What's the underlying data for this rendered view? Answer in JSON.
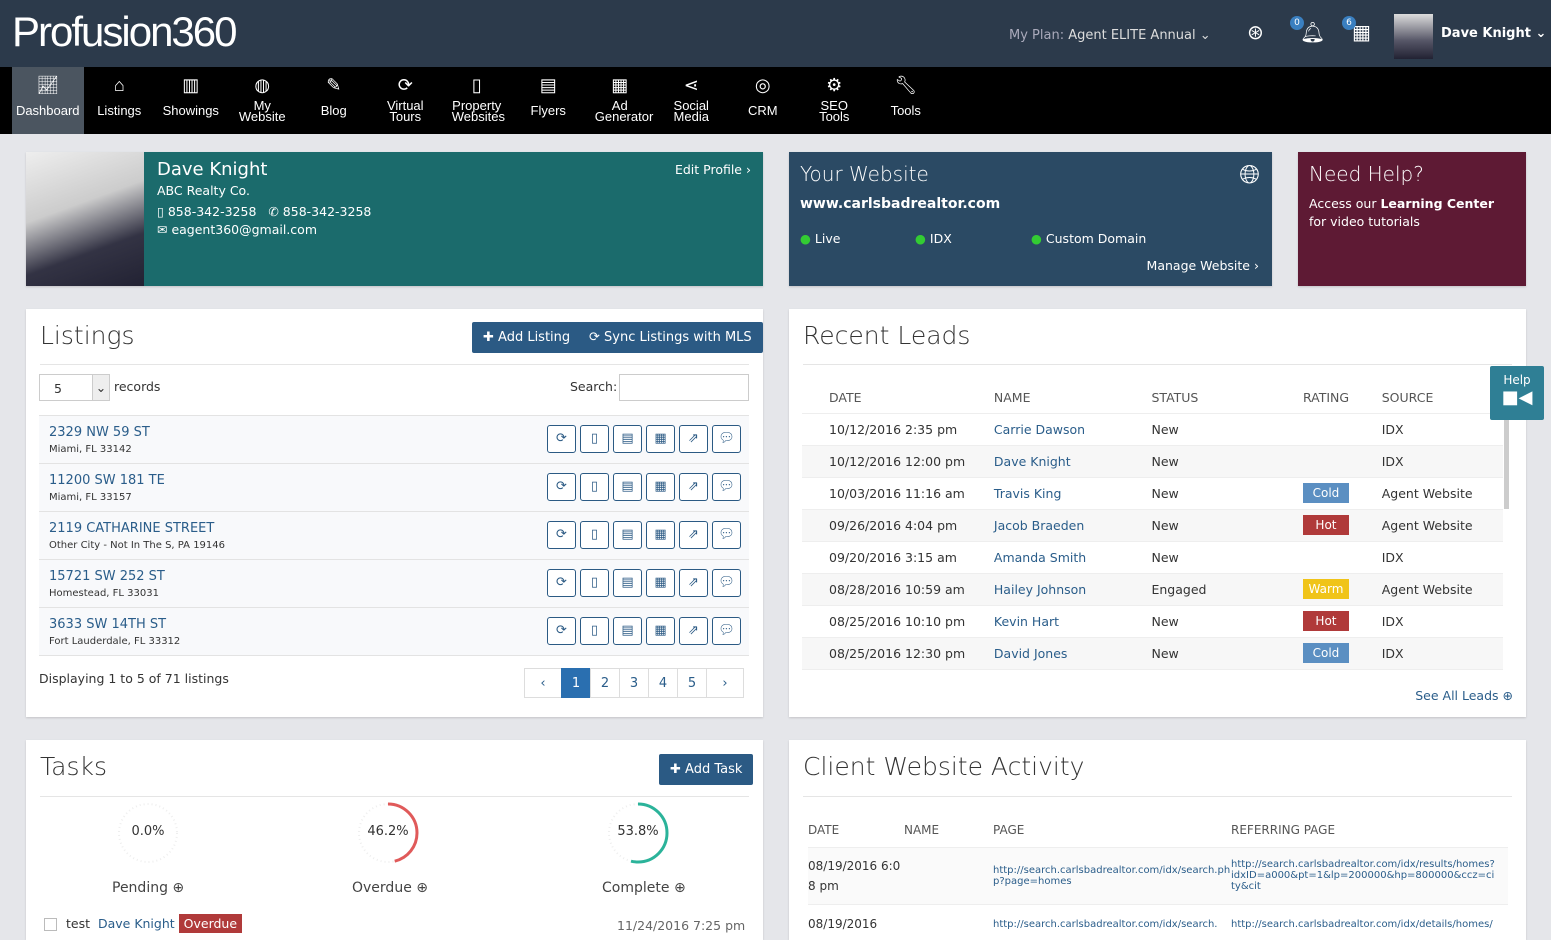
{
  "header": {
    "logo": "Profusion360",
    "plan_label": "My Plan:",
    "plan_value": "Agent ELITE Annual",
    "notifications_count": "0",
    "calendar_count": "6",
    "user_name": "Dave Knight"
  },
  "nav": [
    {
      "label": "Dashboard",
      "icon": "chart-line-icon",
      "active": true
    },
    {
      "label": "Listings",
      "icon": "home-icon"
    },
    {
      "label": "Showings",
      "icon": "bar-chart-icon"
    },
    {
      "label": "My Website",
      "icon": "globe-icon"
    },
    {
      "label": "Blog",
      "icon": "edit-icon"
    },
    {
      "label": "Virtual Tours",
      "icon": "refresh-icon"
    },
    {
      "label": "Property Websites",
      "icon": "mobile-icon"
    },
    {
      "label": "Flyers",
      "icon": "file-icon"
    },
    {
      "label": "Ad Generator",
      "icon": "newspaper-icon"
    },
    {
      "label": "Social Media",
      "icon": "share-icon"
    },
    {
      "label": "CRM",
      "icon": "target-icon"
    },
    {
      "label": "SEO Tools",
      "icon": "gear-icon"
    },
    {
      "label": "Tools",
      "icon": "wrench-icon"
    }
  ],
  "profile": {
    "name": "Dave Knight",
    "company": "ABC Realty Co.",
    "mobile": "858-342-3258",
    "phone": "858-342-3258",
    "email": "eagent360@gmail.com",
    "edit": "Edit Profile",
    "color": "#1b6b6c"
  },
  "website": {
    "title": "Your Website",
    "url": "www.carlsbadrealtor.com",
    "checks": [
      "Live",
      "IDX",
      "Custom Domain"
    ],
    "manage": "Manage Website",
    "color": "#2b4a64"
  },
  "help_panel": {
    "title": "Need Help?",
    "text_pre": "Access our ",
    "link": "Learning Center",
    "text_post": " for video tutorials",
    "color": "#5e1a34"
  },
  "help_tab": "Help",
  "listings": {
    "title": "Listings",
    "add": "Add Listing",
    "sync": "Sync Listings with MLS",
    "page_size": "5",
    "records": "records",
    "search_label": "Search:",
    "search_value": "",
    "rows": [
      {
        "addr": "2329 NW 59 ST",
        "city": "Miami, FL 33142"
      },
      {
        "addr": "11200 SW 181 TE",
        "city": "Miami, FL 33157"
      },
      {
        "addr": "2119 CATHARINE STREET",
        "city": "Other City - Not In The S, PA 19146"
      },
      {
        "addr": "15721 SW 252 ST",
        "city": "Homestead, FL 33031"
      },
      {
        "addr": "3633 SW 14TH ST",
        "city": "Fort Lauderdale, FL 33312"
      }
    ],
    "info": "Displaying 1 to 5 of 71 listings",
    "pages": [
      "‹",
      "1",
      "2",
      "3",
      "4",
      "5",
      "›"
    ],
    "current_page": "1"
  },
  "leads": {
    "title": "Recent Leads",
    "columns": [
      "DATE",
      "NAME",
      "STATUS",
      "RATING",
      "SOURCE"
    ],
    "rows": [
      [
        "10/12/2016 2:35 pm",
        "Carrie Dawson",
        "New",
        "",
        "IDX"
      ],
      [
        "10/12/2016 12:00 pm",
        "Dave Knight",
        "New",
        "",
        "IDX"
      ],
      [
        "10/03/2016 11:16 am",
        "Travis King",
        "New",
        "Cold",
        "Agent Website"
      ],
      [
        "09/26/2016 4:04 pm",
        "Jacob Braeden",
        "New",
        "Hot",
        "Agent Website"
      ],
      [
        "09/20/2016 3:15 am",
        "Amanda Smith",
        "New",
        "",
        "IDX"
      ],
      [
        "08/28/2016 10:59 am",
        "Hailey Johnson",
        "Engaged",
        "Warm",
        "Agent Website"
      ],
      [
        "08/25/2016 10:10 pm",
        "Kevin Hart",
        "New",
        "Hot",
        "IDX"
      ],
      [
        "08/25/2016 12:30 pm",
        "David Jones",
        "New",
        "Cold",
        "IDX"
      ]
    ],
    "rating_colors": {
      "Cold": "#5b8fc2",
      "Hot": "#b03a3a",
      "Warm": "#f0c419"
    },
    "see_all": "See All Leads"
  },
  "tasks": {
    "title": "Tasks",
    "add": "Add Task",
    "stats": [
      {
        "label": "Pending",
        "value": "0.0%",
        "pct": 0,
        "color": "#dddddd"
      },
      {
        "label": "Overdue",
        "value": "46.2%",
        "pct": 46.2,
        "color": "#e05a5a"
      },
      {
        "label": "Complete",
        "value": "53.8%",
        "pct": 53.8,
        "color": "#2bb39a"
      }
    ],
    "first_task": {
      "name": "test",
      "assignee": "Dave Knight",
      "badge": "Overdue",
      "date": "11/24/2016 7:25 pm"
    }
  },
  "activity": {
    "title": "Client Website Activity",
    "columns": [
      "DATE",
      "NAME",
      "PAGE",
      "REFERRING PAGE"
    ],
    "rows": [
      [
        "08/19/2016 6:08 pm",
        "",
        "http://search.carlsbadrealtor.com/idx/search.php?page=homes",
        "http://search.carlsbadrealtor.com/idx/results/homes?idxID=a000&pt=1&lp=200000&hp=800000&ccz=city&cit"
      ],
      [
        "08/19/2016",
        "",
        "http://search.carlsbadrealtor.com/idx/search.",
        "http://search.carlsbadrealtor.com/idx/details/homes/"
      ]
    ]
  }
}
